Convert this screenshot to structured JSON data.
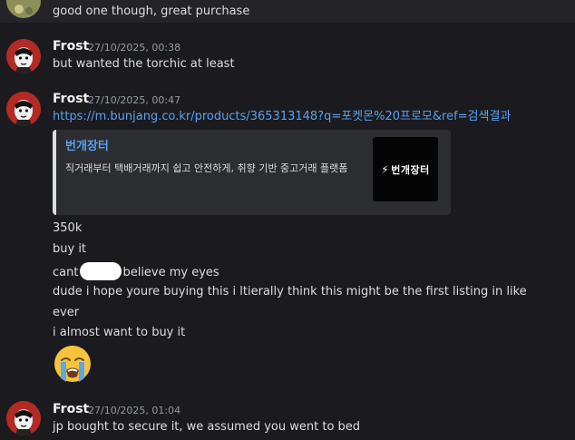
{
  "messages": {
    "prev_text": "good one though, great purchase",
    "msg1": {
      "username": "Frost",
      "timestamp": "27/10/2025, 00:38",
      "text": "but wanted the torchic at least"
    },
    "msg2": {
      "username": "Frost",
      "timestamp": "27/10/2025, 00:47",
      "link": "https://m.bunjang.co.kr/products/365313148?q=포켓몬%20프로모&ref=검색결과",
      "embed": {
        "title": "번개장터",
        "description": "직거래부터 택배거래까지 쉽고 안전하게, 취향 기반 중고거래 플랫폼",
        "thumbnail_text": "번개장터",
        "thumbnail_icon": "lightning-bolt-icon"
      },
      "line1": "350k",
      "line2": "buy it",
      "line3_before": "cant",
      "line3_after": "believe my eyes",
      "line4": "dude i hope youre buying this i ltierally think this might be the first listing in like",
      "line5": "ever",
      "line6": "i almost want to buy it",
      "emoji": "loudly-crying-face-emoji"
    },
    "msg3": {
      "username": "Frost",
      "timestamp": "27/10/2025, 01:04",
      "text": "jp bought to secure it, we assumed you went to bed"
    }
  },
  "colors": {
    "background": "#1b1b1f",
    "link": "#5aa1f0",
    "embed_background": "#2b2d31",
    "avatar_red": "#b42a24"
  }
}
